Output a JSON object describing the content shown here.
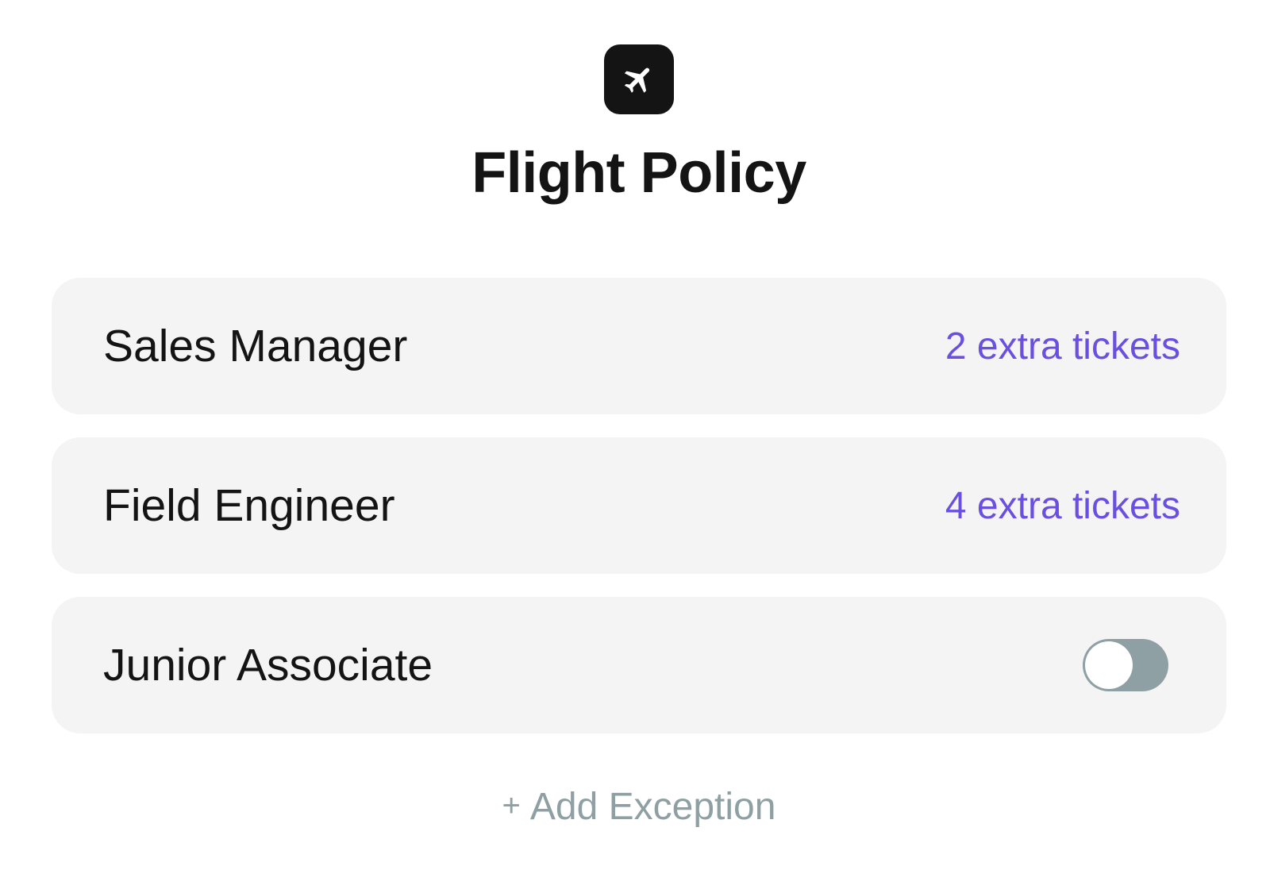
{
  "header": {
    "icon": "airplane-icon",
    "title": "Flight Policy"
  },
  "policies": [
    {
      "role": "Sales Manager",
      "value": "2 extra tickets",
      "type": "text"
    },
    {
      "role": "Field Engineer",
      "value": "4 extra tickets",
      "type": "text"
    },
    {
      "role": "Junior Associate",
      "type": "toggle",
      "toggle_on": false
    }
  ],
  "actions": {
    "add_icon": "+",
    "add_label": "Add Exception"
  },
  "colors": {
    "accent": "#6a4fe0",
    "muted": "#8ea0a3",
    "row_bg": "#f4f4f5",
    "icon_bg": "#141414"
  }
}
